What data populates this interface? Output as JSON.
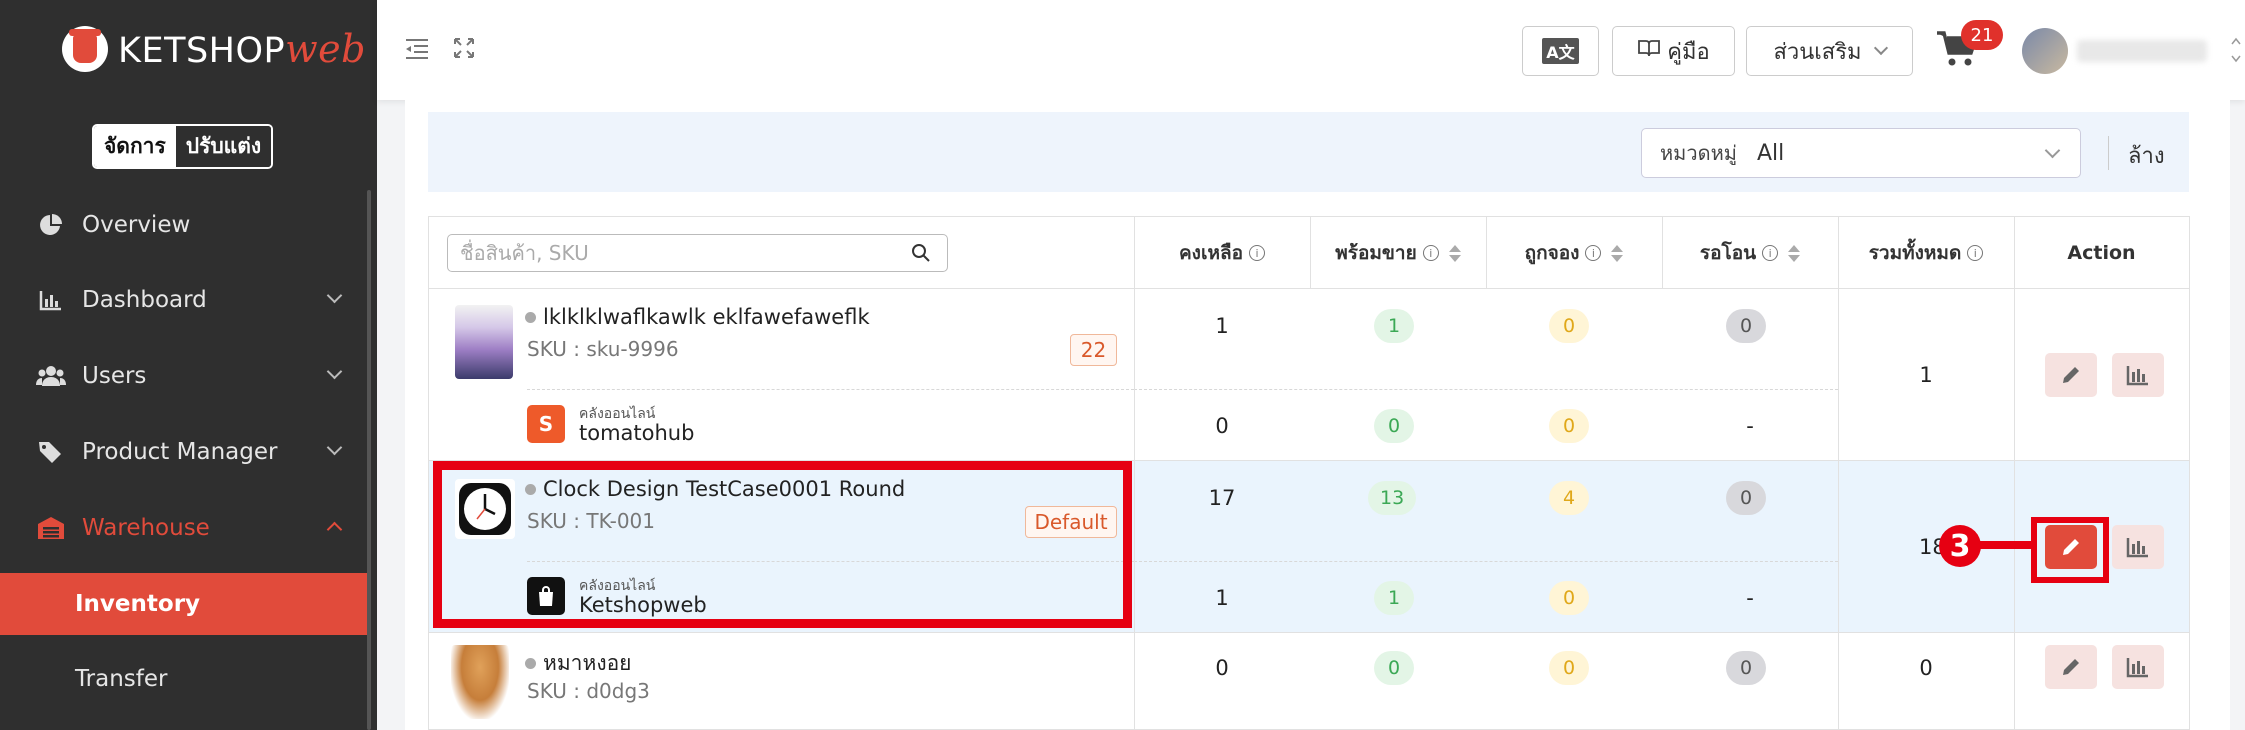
{
  "brand": {
    "name": "KETSHOP",
    "suffix": "web"
  },
  "mode_toggle": {
    "active": "จัดการ",
    "inactive": "ปรับแต่ง"
  },
  "sidebar": {
    "items": [
      {
        "label": "Overview",
        "icon": "pie-chart-icon"
      },
      {
        "label": "Dashboard",
        "icon": "bar-chart-icon"
      },
      {
        "label": "Users",
        "icon": "users-icon"
      },
      {
        "label": "Product Manager",
        "icon": "tag-icon"
      },
      {
        "label": "Warehouse",
        "icon": "warehouse-icon"
      }
    ],
    "sub_items": [
      {
        "label": "Inventory",
        "active": true
      },
      {
        "label": "Transfer",
        "active": false
      }
    ]
  },
  "topbar": {
    "translate_label": "A文",
    "manual_label": "คู่มือ",
    "addons_label": "ส่วนเสริม",
    "cart_count": "21"
  },
  "filter": {
    "category_label": "หมวดหมู่",
    "category_value": "All",
    "clear_label": "ล้าง"
  },
  "table": {
    "search_placeholder": "ชื่อสินค้า, SKU",
    "headers": {
      "remaining": "คงเหลือ",
      "available": "พร้อมขาย",
      "reserved": "ถูกจอง",
      "pending": "รอโอน",
      "total": "รวมทั้งหมด",
      "action": "Action"
    },
    "rows": [
      {
        "name": "lklklklwaflkawlk eklfawefaweflk",
        "sku": "SKU : sku-9996",
        "tag": "22",
        "remaining": "1",
        "available": "1",
        "reserved": "0",
        "pending": "0",
        "store_label": "คลังออนไลน์",
        "store_name": "tomatohub",
        "store_remaining": "0",
        "store_available": "0",
        "store_reserved": "0",
        "store_pending": "-",
        "total": "1"
      },
      {
        "name": "Clock Design TestCase0001 Round",
        "sku": "SKU : TK-001",
        "tag": "Default",
        "remaining": "17",
        "available": "13",
        "reserved": "4",
        "pending": "0",
        "store_label": "คลังออนไลน์",
        "store_name": "Ketshopweb",
        "store_remaining": "1",
        "store_available": "1",
        "store_reserved": "0",
        "store_pending": "-",
        "total": "18"
      },
      {
        "name": "หมาหงอย",
        "sku": "SKU : d0dg3",
        "remaining": "0",
        "available": "0",
        "reserved": "0",
        "pending": "0",
        "total": "0"
      }
    ]
  },
  "annotation": {
    "step": "3"
  },
  "colors": {
    "accent": "#e14b3b",
    "highlight": "#e60012",
    "sidebar": "#2f2f2f"
  }
}
